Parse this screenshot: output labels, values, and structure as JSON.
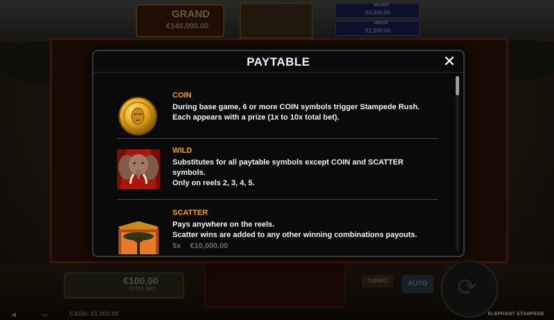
{
  "header": {
    "grand_label": "GRAND",
    "grand_value": "€140,000.00",
    "jackpots": [
      {
        "label": "MAJOR",
        "value": "€4,000.00"
      },
      {
        "label": "MINOR",
        "value": "€1,500.00"
      }
    ]
  },
  "footer": {
    "bet_value": "€100.00",
    "bet_label": "TOTAL BET",
    "cash_text": "CASH: €1,000.00",
    "auto_label": "AUTO",
    "turbo_label": "TURBO",
    "game_name": "ELEPHANT STAMPEDE"
  },
  "modal": {
    "title": "PAYTABLE",
    "close_icon": "close-x-icon",
    "entries": [
      {
        "name": "COIN",
        "icon": "gold-coin-icon",
        "desc_lines": [
          "During base game, 6 or more COIN symbols trigger Stampede Rush.",
          "Each appears with a prize (1x to 10x total bet)."
        ]
      },
      {
        "name": "WILD",
        "icon": "elephant-wild-icon",
        "desc_lines": [
          "Substitutes for all paytable symbols except COIN and SCATTER",
          "symbols.",
          "Only on reels 2, 3, 4, 5."
        ]
      },
      {
        "name": "SCATTER",
        "icon": "acacia-tree-scatter-icon",
        "desc_lines": [
          "Pays anywhere on the reels.",
          "Scatter wins are added to any other winning combinations payouts."
        ],
        "payouts": [
          {
            "count": "5x",
            "amount": "€10,000.00"
          }
        ]
      }
    ]
  },
  "colors": {
    "accent_orange": "#f2a21b",
    "modal_bg": "#0a0a0a",
    "text_white": "#f4f4f4"
  }
}
